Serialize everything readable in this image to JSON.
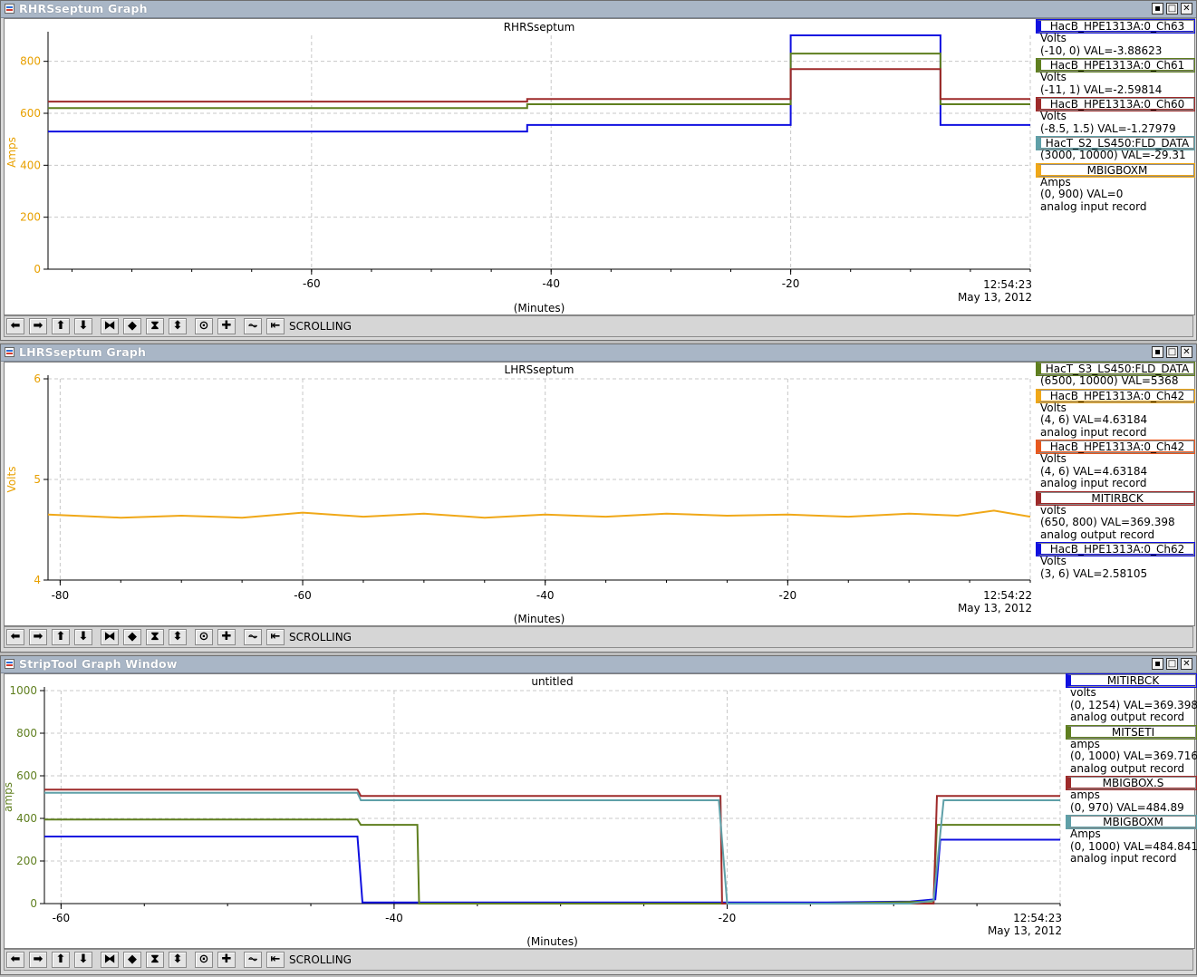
{
  "windows": [
    {
      "title": "RHRSseptum Graph",
      "graph_title": "RHRSseptum",
      "ylabel": "Amps",
      "xlabel": "(Minutes)",
      "time": "12:54:23",
      "date": "May 13, 2012",
      "mode": "SCROLLING",
      "legend": [
        {
          "name": "HacB_HPE1313A:0_Ch63",
          "lines": [
            "Volts",
            "(-10, 0) VAL=-3.88623"
          ],
          "color": "#1010e0"
        },
        {
          "name": "HacB_HPE1313A:0_Ch61",
          "lines": [
            "Volts",
            "(-11, 1) VAL=-2.59814"
          ],
          "color": "#5f7f1f"
        },
        {
          "name": "HacB_HPE1313A:0_Ch60",
          "lines": [
            "Volts",
            "(-8.5, 1.5) VAL=-1.27979"
          ],
          "color": "#9e2a2a"
        },
        {
          "name": "HacT_S2_LS450:FLD_DATA",
          "lines": [
            "(3000, 10000) VAL=-29.31"
          ],
          "color": "#5fa0a8"
        },
        {
          "name": "MBIGBOXM",
          "lines": [
            "Amps",
            "(0, 900) VAL=0",
            "analog input record"
          ],
          "color": "#f0a818"
        }
      ]
    },
    {
      "title": "LHRSseptum Graph",
      "graph_title": "LHRSseptum",
      "ylabel": "Volts",
      "xlabel": "(Minutes)",
      "time": "12:54:22",
      "date": "May 13, 2012",
      "mode": "SCROLLING",
      "legend": [
        {
          "name": "HacT_S3_LS450:FLD_DATA",
          "lines": [
            "(6500, 10000) VAL=5368"
          ],
          "color": "#5f7f1f"
        },
        {
          "name": "HacB_HPE1313A:0_Ch42",
          "lines": [
            "Volts",
            "(4, 6) VAL=4.63184",
            "analog input record"
          ],
          "color": "#f0a818"
        },
        {
          "name": "HacB_HPE1313A:0_Ch42",
          "lines": [
            "Volts",
            "(4, 6) VAL=4.63184",
            "analog input record"
          ],
          "color": "#e8581e"
        },
        {
          "name": "MITIRBCK",
          "lines": [
            "volts",
            "(650, 800) VAL=369.398",
            "analog output record"
          ],
          "color": "#9e2a2a"
        },
        {
          "name": "HacB_HPE1313A:0_Ch62",
          "lines": [
            "Volts",
            "(3, 6) VAL=2.58105"
          ],
          "color": "#1010e0"
        }
      ]
    },
    {
      "title": "StripTool Graph Window",
      "graph_title": "untitled",
      "ylabel": "amps",
      "xlabel": "(Minutes)",
      "time": "12:54:23",
      "date": "May 13, 2012",
      "mode": "SCROLLING",
      "legend": [
        {
          "name": "MITIRBCK",
          "lines": [
            "volts",
            "(0, 1254) VAL=369.398",
            "analog output record"
          ],
          "color": "#1010e0"
        },
        {
          "name": "MITSETI",
          "lines": [
            "amps",
            "(0, 1000) VAL=369.716",
            "analog output record"
          ],
          "color": "#5f7f1f"
        },
        {
          "name": "MBIGBOX.S",
          "lines": [
            "amps",
            "(0, 970) VAL=484.89"
          ],
          "color": "#9e2a2a"
        },
        {
          "name": "MBIGBOXM",
          "lines": [
            "Amps",
            "(0, 1000) VAL=484.841",
            "analog input record"
          ],
          "color": "#5fa0a8"
        }
      ]
    }
  ],
  "chart_data": [
    {
      "type": "line",
      "title": "RHRSseptum",
      "xlabel": "(Minutes)",
      "ylabel": "Amps",
      "xlim": [
        -82,
        0
      ],
      "ylim": [
        0,
        900
      ],
      "xticks": [
        -60,
        -40,
        -20
      ],
      "yticks": [
        0,
        200,
        400,
        600,
        800
      ],
      "grid": true,
      "series": [
        {
          "name": "HacB_HPE1313A:0_Ch63",
          "color": "#1010e0",
          "x": [
            -82,
            -42,
            -42,
            -20,
            -20,
            -7.5,
            -7.5,
            0
          ],
          "y": [
            530,
            530,
            555,
            555,
            900,
            900,
            555,
            555
          ]
        },
        {
          "name": "HacB_HPE1313A:0_Ch61",
          "color": "#5f7f1f",
          "x": [
            -82,
            -42,
            -42,
            -20,
            -20,
            -7.5,
            -7.5,
            0
          ],
          "y": [
            620,
            620,
            635,
            635,
            830,
            830,
            635,
            635
          ]
        },
        {
          "name": "HacB_HPE1313A:0_Ch60",
          "color": "#9e2a2a",
          "x": [
            -82,
            -42,
            -42,
            -20,
            -20,
            -7.5,
            -7.5,
            0
          ],
          "y": [
            645,
            645,
            655,
            655,
            770,
            770,
            655,
            655
          ]
        }
      ]
    },
    {
      "type": "line",
      "title": "LHRSseptum",
      "xlabel": "(Minutes)",
      "ylabel": "Volts",
      "xlim": [
        -81,
        0
      ],
      "ylim": [
        4,
        6
      ],
      "xticks": [
        -80,
        -60,
        -40,
        -20
      ],
      "yticks": [
        4,
        5,
        6
      ],
      "grid": true,
      "series": [
        {
          "name": "HacB_HPE1313A:0_Ch42",
          "color": "#f0a818",
          "x": [
            -81,
            -75,
            -70,
            -65,
            -60,
            -55,
            -50,
            -45,
            -40,
            -35,
            -30,
            -25,
            -20,
            -15,
            -10,
            -6,
            -3,
            0
          ],
          "y": [
            4.65,
            4.62,
            4.64,
            4.62,
            4.67,
            4.63,
            4.66,
            4.62,
            4.65,
            4.63,
            4.66,
            4.64,
            4.65,
            4.63,
            4.66,
            4.64,
            4.69,
            4.63
          ]
        }
      ]
    },
    {
      "type": "line",
      "title": "untitled",
      "xlabel": "(Minutes)",
      "ylabel": "amps",
      "xlim": [
        -61,
        0
      ],
      "ylim": [
        0,
        1000
      ],
      "xticks": [
        -60,
        -40,
        -20
      ],
      "yticks": [
        0,
        200,
        400,
        600,
        800,
        1000
      ],
      "grid": true,
      "series": [
        {
          "name": "MITIRBCK",
          "color": "#1010e0",
          "x": [
            -61,
            -42.2,
            -41.9,
            -38.5,
            -14,
            -9,
            -7.5,
            -7.2,
            0
          ],
          "y": [
            315,
            315,
            5,
            5,
            5,
            10,
            20,
            300,
            300
          ]
        },
        {
          "name": "MITSETI",
          "color": "#5f7f1f",
          "x": [
            -61,
            -42.2,
            -42,
            -38.6,
            -38.5,
            -14,
            -7.6,
            -7.4,
            0
          ],
          "y": [
            395,
            395,
            370,
            370,
            0,
            0,
            10,
            370,
            370
          ]
        },
        {
          "name": "MBIGBOX.S",
          "color": "#9e2a2a",
          "x": [
            -61,
            -42.2,
            -42,
            -20.4,
            -20.3,
            -7.6,
            -7.4,
            0
          ],
          "y": [
            535,
            535,
            505,
            505,
            0,
            0,
            505,
            505
          ]
        },
        {
          "name": "MBIGBOXM",
          "color": "#5fa0a8",
          "x": [
            -61,
            -42.2,
            -42,
            -20.5,
            -20,
            -9,
            -7.6,
            -7,
            0
          ],
          "y": [
            520,
            520,
            485,
            485,
            0,
            0,
            15,
            485,
            485
          ]
        }
      ]
    }
  ]
}
